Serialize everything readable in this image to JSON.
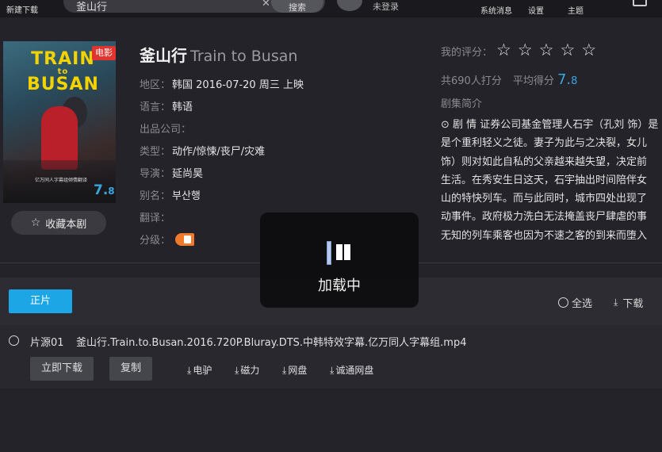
{
  "topbar": {
    "new_download": "新建下载",
    "search_value": "釜山行",
    "search_clear": "✕",
    "search_button": "搜索",
    "login": "未登录",
    "system_messages": "系统消息",
    "settings": "设置",
    "theme": "主题"
  },
  "poster": {
    "title_line1": "TRAIN",
    "title_line2": "to",
    "title_line3": "BUSAN",
    "tag": "电影",
    "rating_int": "7.",
    "rating_dec": "8",
    "subcaption": "亿万同人字幕组倾情翻译"
  },
  "favorite_button": "收藏本剧",
  "movie": {
    "title_cn": "釜山行",
    "title_en": "Train to Busan",
    "info": [
      {
        "label": "地区：",
        "value": "韩国  2016-07-20 周三  上映"
      },
      {
        "label": "语言：",
        "value": "韩语"
      },
      {
        "label": "出品公司：",
        "value": ""
      },
      {
        "label": "类型：",
        "value": "动作/惊悚/丧尸/灾难"
      },
      {
        "label": "导演：",
        "value": "延尚昊"
      },
      {
        "label": "别名：",
        "value": "부산행"
      },
      {
        "label": "翻译：",
        "value": ""
      },
      {
        "label": "分级：",
        "value": ""
      }
    ]
  },
  "rating": {
    "my_rating_label": "我的评分：",
    "stars": [
      "☆",
      "☆",
      "☆",
      "☆",
      "☆"
    ],
    "count_text": "共690人打分",
    "avg_label": "平均得分",
    "avg_int": "7.",
    "avg_dec": "8"
  },
  "synopsis": {
    "title": "剧集简介",
    "lines": [
      "⊙ 剧 情 证券公司基金管理人石宇（孔刘 饰）是",
      "是个重利轻义之徒。妻子为此与之决裂，女儿",
      "饰）则对如此自私的父亲越来越失望，决定前",
      "生活。在秀安生日这天，石宇抽出时间陪伴女",
      "山的特快列车。而与此同时，城市四处出现了",
      "动事件。政府极力洗白无法掩盖丧尸肆虐的事",
      "无知的列车乘客也因为不速之客的到来而堕入"
    ]
  },
  "resources": {
    "tab": "正片",
    "select_all": "全选",
    "download": "下载",
    "items": [
      {
        "source": "片源01",
        "filename": "釜山行.Train.to.Busan.2016.720P.Bluray.DTS.中韩特效字幕.亿万同人字幕组.mp4",
        "download_now": "立即下载",
        "copy": "复制",
        "links": [
          "电驴",
          "磁力",
          "网盘",
          "诚通网盘"
        ]
      }
    ]
  },
  "loading": {
    "message": "加载中"
  },
  "colors": {
    "accent": "#1da6e6",
    "rating": "#3aa6e0",
    "poster_tag": "#e2342e",
    "grade_badge": "#f07a2a"
  }
}
